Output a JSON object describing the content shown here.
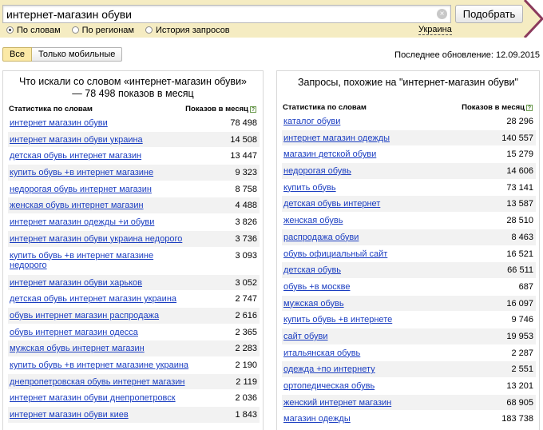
{
  "search": {
    "query": "интернет-магазин обуви",
    "submit_label": "Подобрать",
    "clear_symbol": "×"
  },
  "modes": [
    {
      "label": "По словам",
      "selected": true
    },
    {
      "label": "По регионам",
      "selected": false
    },
    {
      "label": "История запросов",
      "selected": false
    }
  ],
  "region": "Украина",
  "filters": {
    "all_label": "Все",
    "mobile_label": "Только мобильные"
  },
  "last_update": "Последнее обновление: 12.09.2015",
  "left_panel": {
    "title": "Что искали со словом «интернет-магазин обуви» — 78 498 показов в месяц",
    "col_phrase": "Статистика по словам",
    "col_count": "Показов в месяц",
    "help": "?",
    "rows": [
      {
        "phrase": "интернет магазин обуви",
        "count": "78 498"
      },
      {
        "phrase": "интернет магазин обуви украина",
        "count": "14 508"
      },
      {
        "phrase": "детская обувь интернет магазин",
        "count": "13 447"
      },
      {
        "phrase": "купить обувь +в интернет магазине",
        "count": "9 323"
      },
      {
        "phrase": "недорогая обувь интернет магазин",
        "count": "8 758"
      },
      {
        "phrase": "женская обувь интернет магазин",
        "count": "4 488"
      },
      {
        "phrase": "интернет магазин одежды +и обуви",
        "count": "3 826"
      },
      {
        "phrase": "интернет магазин обуви украина недорого",
        "count": "3 736"
      },
      {
        "phrase": "купить обувь +в интернет магазине недорого",
        "count": "3 093"
      },
      {
        "phrase": "интернет магазин обуви харьков",
        "count": "3 052"
      },
      {
        "phrase": "детская обувь интернет магазин украина",
        "count": "2 747"
      },
      {
        "phrase": "обувь интернет магазин распродажа",
        "count": "2 616"
      },
      {
        "phrase": "обувь интернет магазин одесса",
        "count": "2 365"
      },
      {
        "phrase": "мужская обувь интернет магазин",
        "count": "2 283"
      },
      {
        "phrase": "купить обувь +в интернет магазине украина",
        "count": "2 190"
      },
      {
        "phrase": "днепропетровская обувь интернет магазин",
        "count": "2 119"
      },
      {
        "phrase": "интернет магазин обуви днепропетровск",
        "count": "2 036"
      },
      {
        "phrase": "интернет магазин обуви киев",
        "count": "1 843"
      }
    ]
  },
  "right_panel": {
    "title": "Запросы, похожие на \"интернет-магазин обуви\"",
    "col_phrase": "Статистика по словам",
    "col_count": "Показов в месяц",
    "help": "?",
    "rows": [
      {
        "phrase": "каталог обуви",
        "count": "28 296"
      },
      {
        "phrase": "интернет магазин одежды",
        "count": "140 557"
      },
      {
        "phrase": "магазин детской обуви",
        "count": "15 279"
      },
      {
        "phrase": "недорогая обувь",
        "count": "14 606"
      },
      {
        "phrase": "купить обувь",
        "count": "73 141"
      },
      {
        "phrase": "детская обувь интернет",
        "count": "13 587"
      },
      {
        "phrase": "женская обувь",
        "count": "28 510"
      },
      {
        "phrase": "распродажа обуви",
        "count": "8 463"
      },
      {
        "phrase": "обувь официальный сайт",
        "count": "16 521"
      },
      {
        "phrase": "детская обувь",
        "count": "66 511"
      },
      {
        "phrase": "обувь +в москве",
        "count": "687"
      },
      {
        "phrase": "мужская обувь",
        "count": "16 097"
      },
      {
        "phrase": "купить обувь +в интернете",
        "count": "9 746"
      },
      {
        "phrase": "сайт обуви",
        "count": "19 953"
      },
      {
        "phrase": "итальянская обувь",
        "count": "2 287"
      },
      {
        "phrase": "одежда +по интернету",
        "count": "2 551"
      },
      {
        "phrase": "ортопедическая обувь",
        "count": "13 201"
      },
      {
        "phrase": "женский интернет магазин",
        "count": "68 905"
      },
      {
        "phrase": "магазин одежды",
        "count": "183 738"
      }
    ]
  }
}
